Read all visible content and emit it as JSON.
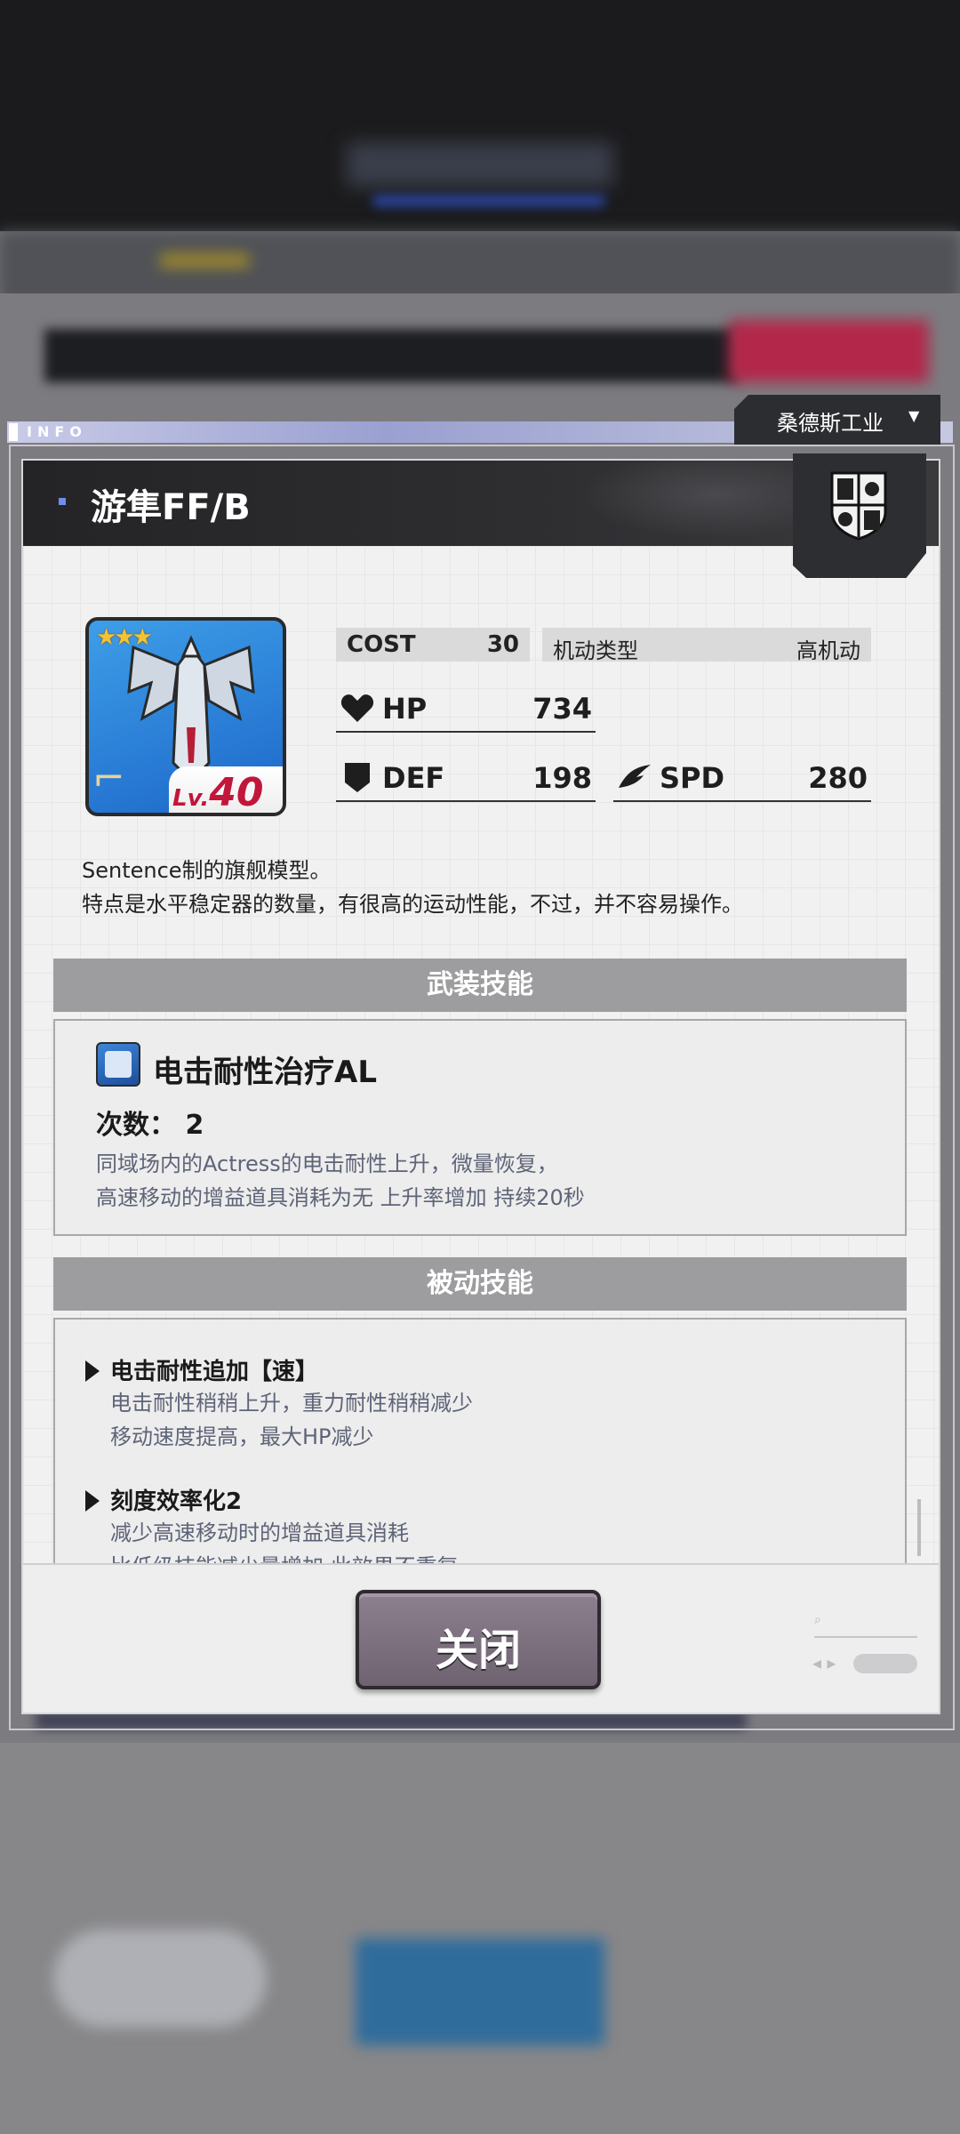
{
  "header": {
    "info_label": "INFO",
    "manufacturer": "桑德斯工业",
    "manufacturer_caret": "▼"
  },
  "dialog": {
    "title": "游隼FF/B",
    "emblem_icon": "crest-shield-icon"
  },
  "unit": {
    "stars": "★★★",
    "level_prefix": "Lv.",
    "level": "40"
  },
  "stats": {
    "cost_label": "COST",
    "cost_value": "30",
    "mobility_label": "机动类型",
    "mobility_value": "高机动",
    "hp_label": "HP",
    "hp_value": "734",
    "def_label": "DEF",
    "def_value": "198",
    "spd_label": "SPD",
    "spd_value": "280"
  },
  "description": {
    "line1": "Sentence制的旗舰模型。",
    "line2": "特点是水平稳定器的数量，有很高的运动性能，不过，并不容易操作。"
  },
  "weapon_skill": {
    "header": "武装技能",
    "name": "电击耐性治疗AL",
    "count": "次数：  2",
    "desc_line1": "同域场内的Actress的电击耐性上升，微量恢复，",
    "desc_line2": "高速移动的增益道具消耗为无  上升率增加  持续20秒"
  },
  "passive_skill": {
    "header": "被动技能",
    "items": [
      {
        "title": "电击耐性追加【速】",
        "lines": [
          "电击耐性稍稍上升，重力耐性稍稍减少",
          "移动速度提高，最大HP减少"
        ]
      },
      {
        "title": "刻度效率化2",
        "lines": [
          "减少高速移动时的增益道具消耗",
          "比低级技能减少量增加  此效果不重复"
        ]
      }
    ]
  },
  "footer": {
    "close_label": "关闭"
  },
  "colors": {
    "header_dark": "#2c2d31",
    "section_bar": "#9d9d9f",
    "close_button": "#7d7080",
    "level_red": "#c2163a",
    "star_gold": "#f5c232"
  }
}
